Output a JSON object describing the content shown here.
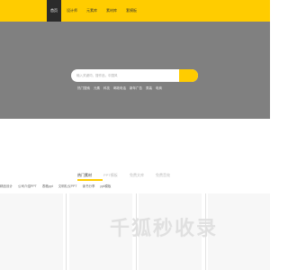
{
  "header": {
    "brand_color": "#ffcc00",
    "nav": [
      {
        "label": "首页",
        "active": true
      },
      {
        "label": "设计师"
      },
      {
        "label": "元素库"
      },
      {
        "label": "素材库"
      },
      {
        "label": "套模板"
      }
    ]
  },
  "hero": {
    "background_color": "#808080",
    "search": {
      "placeholder": "输入关键词，搜作品，中国风",
      "value": "",
      "button_icon": "search-icon"
    },
    "hot_words": [
      "热门搜索",
      "元素",
      "科技",
      "邮政电话",
      "新年广告",
      "男装",
      "电商"
    ]
  },
  "content": {
    "tabs": [
      {
        "label": "热门素材",
        "active": true
      },
      {
        "label": "PPT模板"
      },
      {
        "label": "免费文库"
      },
      {
        "label": "免费音效"
      }
    ],
    "sub_tabs": [
      "精品设计",
      "公司介绍PPT",
      "表格ppt",
      "文明礼仪PPT",
      "读书分享",
      "ppt模板"
    ]
  },
  "watermark": "千狐秒收录"
}
